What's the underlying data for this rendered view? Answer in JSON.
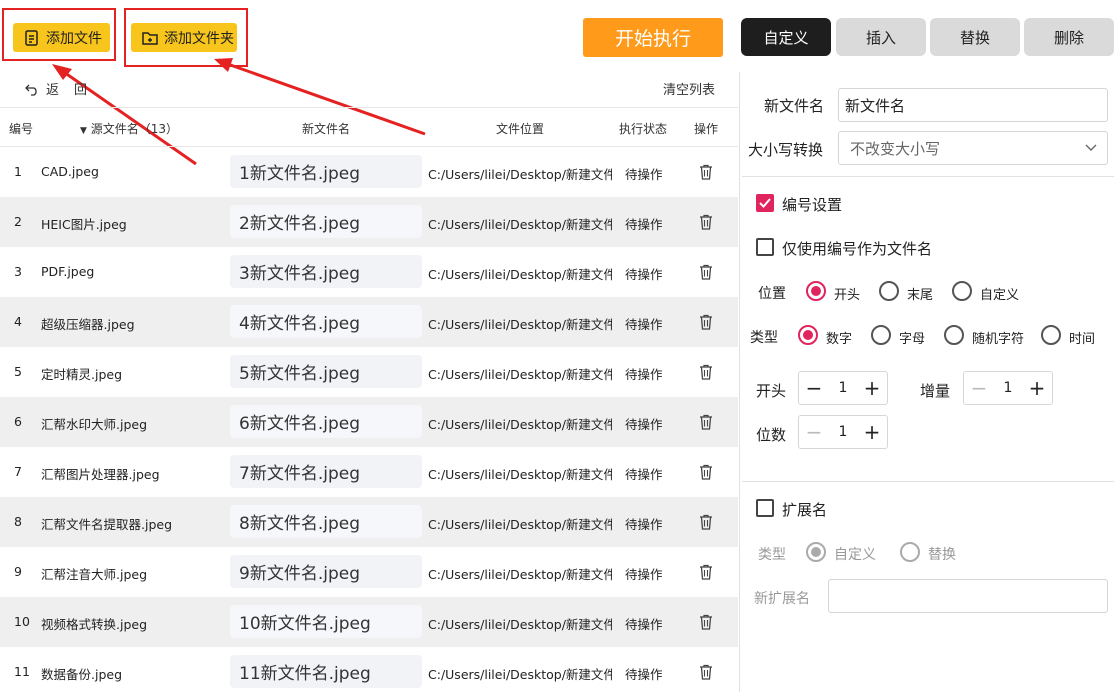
{
  "toolbar": {
    "add_file": "添加文件",
    "add_folder": "添加文件夹",
    "start": "开始执行"
  },
  "tabs": [
    {
      "label": "自定义",
      "active": true
    },
    {
      "label": "插入",
      "active": false
    },
    {
      "label": "替换",
      "active": false
    },
    {
      "label": "删除",
      "active": false
    }
  ],
  "subtoolbar": {
    "back": "返",
    "forward": "回",
    "clear_list": "清空列表"
  },
  "table": {
    "headers": {
      "index": "编号",
      "source": "源文件名（13）",
      "new_name": "新文件名",
      "location": "文件位置",
      "status": "执行状态",
      "op": "操作"
    },
    "rows": [
      {
        "index": "1",
        "source": "CAD.jpeg",
        "new_name": "1新文件名.jpeg",
        "location": "C:/Users/lilei/Desktop/新建文件夹",
        "status": "待操作"
      },
      {
        "index": "2",
        "source": "HEIC图片.jpeg",
        "new_name": "2新文件名.jpeg",
        "location": "C:/Users/lilei/Desktop/新建文件夹",
        "status": "待操作"
      },
      {
        "index": "3",
        "source": "PDF.jpeg",
        "new_name": "3新文件名.jpeg",
        "location": "C:/Users/lilei/Desktop/新建文件夹",
        "status": "待操作"
      },
      {
        "index": "4",
        "source": "超级压缩器.jpeg",
        "new_name": "4新文件名.jpeg",
        "location": "C:/Users/lilei/Desktop/新建文件夹",
        "status": "待操作"
      },
      {
        "index": "5",
        "source": "定时精灵.jpeg",
        "new_name": "5新文件名.jpeg",
        "location": "C:/Users/lilei/Desktop/新建文件夹",
        "status": "待操作"
      },
      {
        "index": "6",
        "source": "汇帮水印大师.jpeg",
        "new_name": "6新文件名.jpeg",
        "location": "C:/Users/lilei/Desktop/新建文件夹",
        "status": "待操作"
      },
      {
        "index": "7",
        "source": "汇帮图片处理器.jpeg",
        "new_name": "7新文件名.jpeg",
        "location": "C:/Users/lilei/Desktop/新建文件夹",
        "status": "待操作"
      },
      {
        "index": "8",
        "source": "汇帮文件名提取器.jpeg",
        "new_name": "8新文件名.jpeg",
        "location": "C:/Users/lilei/Desktop/新建文件夹",
        "status": "待操作"
      },
      {
        "index": "9",
        "source": "汇帮注音大师.jpeg",
        "new_name": "9新文件名.jpeg",
        "location": "C:/Users/lilei/Desktop/新建文件夹",
        "status": "待操作"
      },
      {
        "index": "10",
        "source": "视频格式转换.jpeg",
        "new_name": "10新文件名.jpeg",
        "location": "C:/Users/lilei/Desktop/新建文件夹",
        "status": "待操作"
      },
      {
        "index": "11",
        "source": "数据备份.jpeg",
        "new_name": "11新文件名.jpeg",
        "location": "C:/Users/lilei/Desktop/新建文件夹",
        "status": "待操作"
      }
    ]
  },
  "panel": {
    "new_name_label": "新文件名",
    "new_name_value": "新文件名",
    "case_label": "大小写转换",
    "case_value": "不改变大小写",
    "numbering_label": "编号设置",
    "numbering_checked": true,
    "only_number_label": "仅使用编号作为文件名",
    "only_number_checked": false,
    "position_label": "位置",
    "position_options": [
      "开头",
      "末尾",
      "自定义"
    ],
    "position_selected": "开头",
    "type_label": "类型",
    "type_options": [
      "数字",
      "字母",
      "随机字符",
      "时间"
    ],
    "type_selected": "数字",
    "start_label": "开头",
    "start_value": "1",
    "increment_label": "增量",
    "increment_value": "1",
    "digits_label": "位数",
    "digits_value": "1",
    "ext_label": "扩展名",
    "ext_checked": false,
    "ext_type_label": "类型",
    "ext_type_options": [
      "自定义",
      "替换"
    ],
    "ext_type_selected": "自定义",
    "new_ext_label": "新扩展名",
    "new_ext_value": ""
  },
  "colors": {
    "accent_yellow": "#f8c51c",
    "start_orange": "#ff9a1a",
    "highlight_red": "#e52222",
    "check_pink": "#e0245e",
    "tab_active": "#1e1e1e"
  }
}
